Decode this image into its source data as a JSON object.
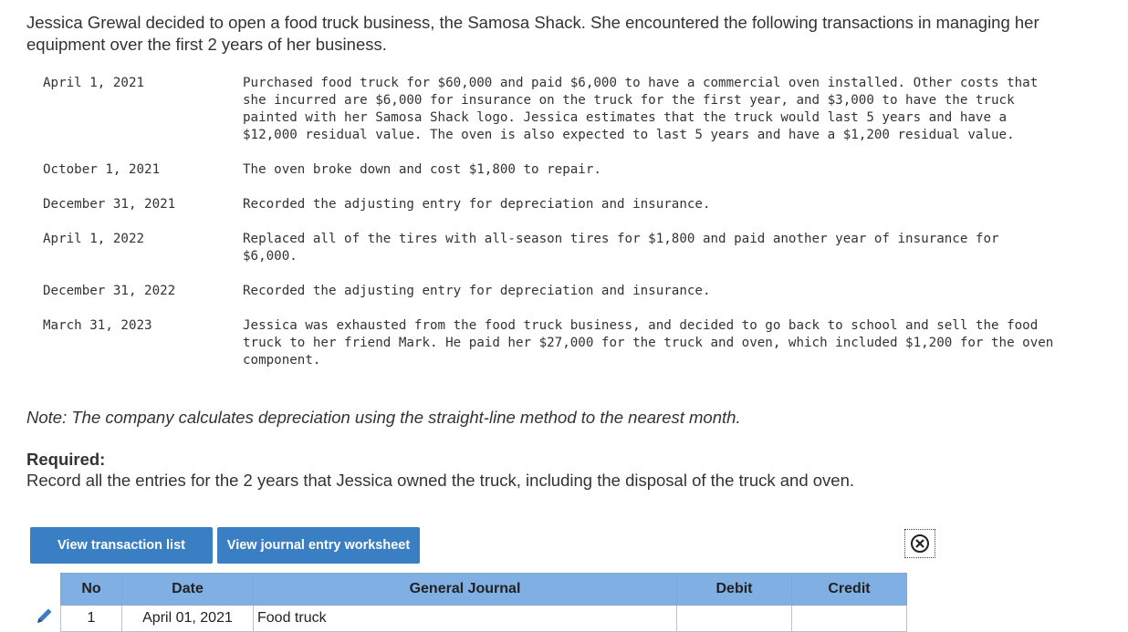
{
  "intro": "Jessica Grewal decided to open a food truck business, the Samosa Shack. She encountered the following transactions in managing her equipment over the first 2 years of her business.",
  "transactions": [
    {
      "date": "April 1, 2021",
      "text": "Purchased food truck for $60,000 and paid $6,000 to have a commercial oven installed. Other costs that she incurred are $6,000 for insurance on the truck for the first year, and $3,000 to have the truck painted with her Samosa Shack logo. Jessica estimates that the truck would last 5 years and have a $12,000 residual value. The oven is also expected to last 5 years and have a $1,200 residual value."
    },
    {
      "date": "October 1, 2021",
      "text": "The oven broke down and cost $1,800 to repair."
    },
    {
      "date": "December 31, 2021",
      "text": "Recorded the adjusting entry for depreciation and insurance."
    },
    {
      "date": "April 1, 2022",
      "text": "Replaced all of the tires with all-season tires for $1,800 and paid another year of insurance for $6,000."
    },
    {
      "date": "December 31, 2022",
      "text": "Recorded the adjusting entry for depreciation and insurance."
    },
    {
      "date": "March 31, 2023",
      "text": "Jessica was exhausted from the food truck business, and decided to go back to school and sell the food truck to her friend Mark. He paid her $27,000 for the truck and oven, which included $1,200 for the oven component."
    }
  ],
  "note": "Note: The company calculates depreciation using the straight-line method to the nearest month.",
  "required": {
    "title": "Required:",
    "text": "Record all the entries for the 2 years that Jessica owned the truck, including the disposal of the truck and oven."
  },
  "buttons": {
    "transaction_list": "View transaction list",
    "journal_worksheet": "View journal entry worksheet"
  },
  "icons": {
    "close": "close-circle-icon",
    "edit": "pencil-icon"
  },
  "journal": {
    "headers": {
      "no": "No",
      "date": "Date",
      "general_journal": "General Journal",
      "debit": "Debit",
      "credit": "Credit"
    },
    "rows": [
      {
        "no": "1",
        "date": "April 01, 2021",
        "account": "Food truck",
        "debit": "",
        "credit": ""
      }
    ]
  },
  "colors": {
    "accent": "#3a7ec4",
    "header_bg": "#7fafe3"
  }
}
